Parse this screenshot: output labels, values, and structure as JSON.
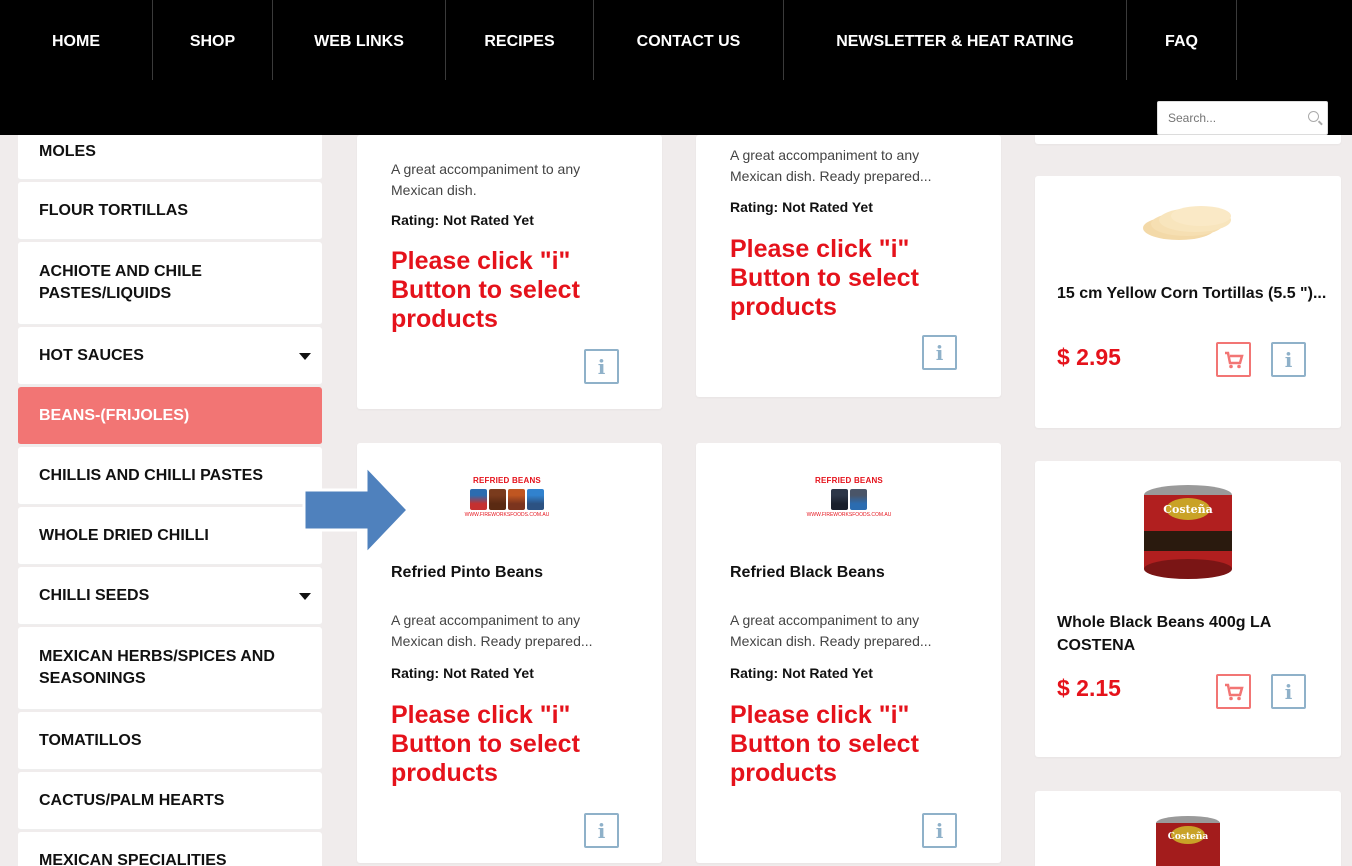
{
  "nav": {
    "items": [
      {
        "label": "HOME"
      },
      {
        "label": "SHOP"
      },
      {
        "label": "WEB LINKS"
      },
      {
        "label": "RECIPES"
      },
      {
        "label": "CONTACT US"
      },
      {
        "label": "NEWSLETTER & HEAT RATING"
      },
      {
        "label": "FAQ"
      }
    ]
  },
  "search": {
    "placeholder": "Search..."
  },
  "sidebar": {
    "items": [
      {
        "label": "MOLES"
      },
      {
        "label": "FLOUR TORTILLAS"
      },
      {
        "label": "ACHIOTE AND CHILE PASTES/LIQUIDS"
      },
      {
        "label": "HOT SAUCES",
        "has_submenu": true
      },
      {
        "label": "BEANS-(FRIJOLES)",
        "active": true
      },
      {
        "label": "CHILLIS AND CHILLI PASTES"
      },
      {
        "label": "WHOLE DRIED CHILLI"
      },
      {
        "label": "CHILLI SEEDS",
        "has_submenu": true
      },
      {
        "label": "MEXICAN HERBS/SPICES AND SEASONINGS"
      },
      {
        "label": "TOMATILLOS"
      },
      {
        "label": "CACTUS/PALM HEARTS"
      },
      {
        "label": "MEXICAN SPECIALITIES"
      }
    ]
  },
  "products": {
    "p1": {
      "desc": "A great accompaniment to any Mexican dish.",
      "rating": "Rating: Not Rated Yet",
      "notice": "Please click \"i\" Button to select products"
    },
    "p2": {
      "desc": "A great accompaniment to any Mexican dish. Ready prepared...",
      "rating": "Rating: Not Rated Yet",
      "notice": "Please click \"i\" Button to select products"
    },
    "p3": {
      "name": "15 cm Yellow Corn Tortillas (5.5 \")...",
      "price": "$ 2.95"
    },
    "p4": {
      "thumb_title": "REFRIED BEANS",
      "thumb_url": "WWW.FIREWORKSFOODS.COM.AU",
      "name": "Refried Pinto Beans",
      "desc": "A great accompaniment to any Mexican dish. Ready prepared...",
      "rating": "Rating: Not Rated Yet",
      "notice": "Please click \"i\" Button to select products"
    },
    "p5": {
      "thumb_title": "REFRIED BEANS",
      "thumb_url": "WWW.FIREWORKSFOODS.COM.AU",
      "name": "Refried Black Beans",
      "desc": "A great accompaniment to any Mexican dish. Ready prepared...",
      "rating": "Rating: Not Rated Yet",
      "notice": "Please click \"i\" Button to select products"
    },
    "p6": {
      "name": "Whole Black Beans 400g LA COSTENA",
      "price": "$ 2.15",
      "logo_text": "Costeña"
    },
    "p7": {
      "logo_text": "Costeña"
    }
  },
  "buttons": {
    "info_glyph": "i"
  },
  "colors": {
    "accent": "#f27574",
    "price_red": "#e5121b",
    "info_blue": "#8fb1c9",
    "arrow_blue": "#4f81bd"
  }
}
